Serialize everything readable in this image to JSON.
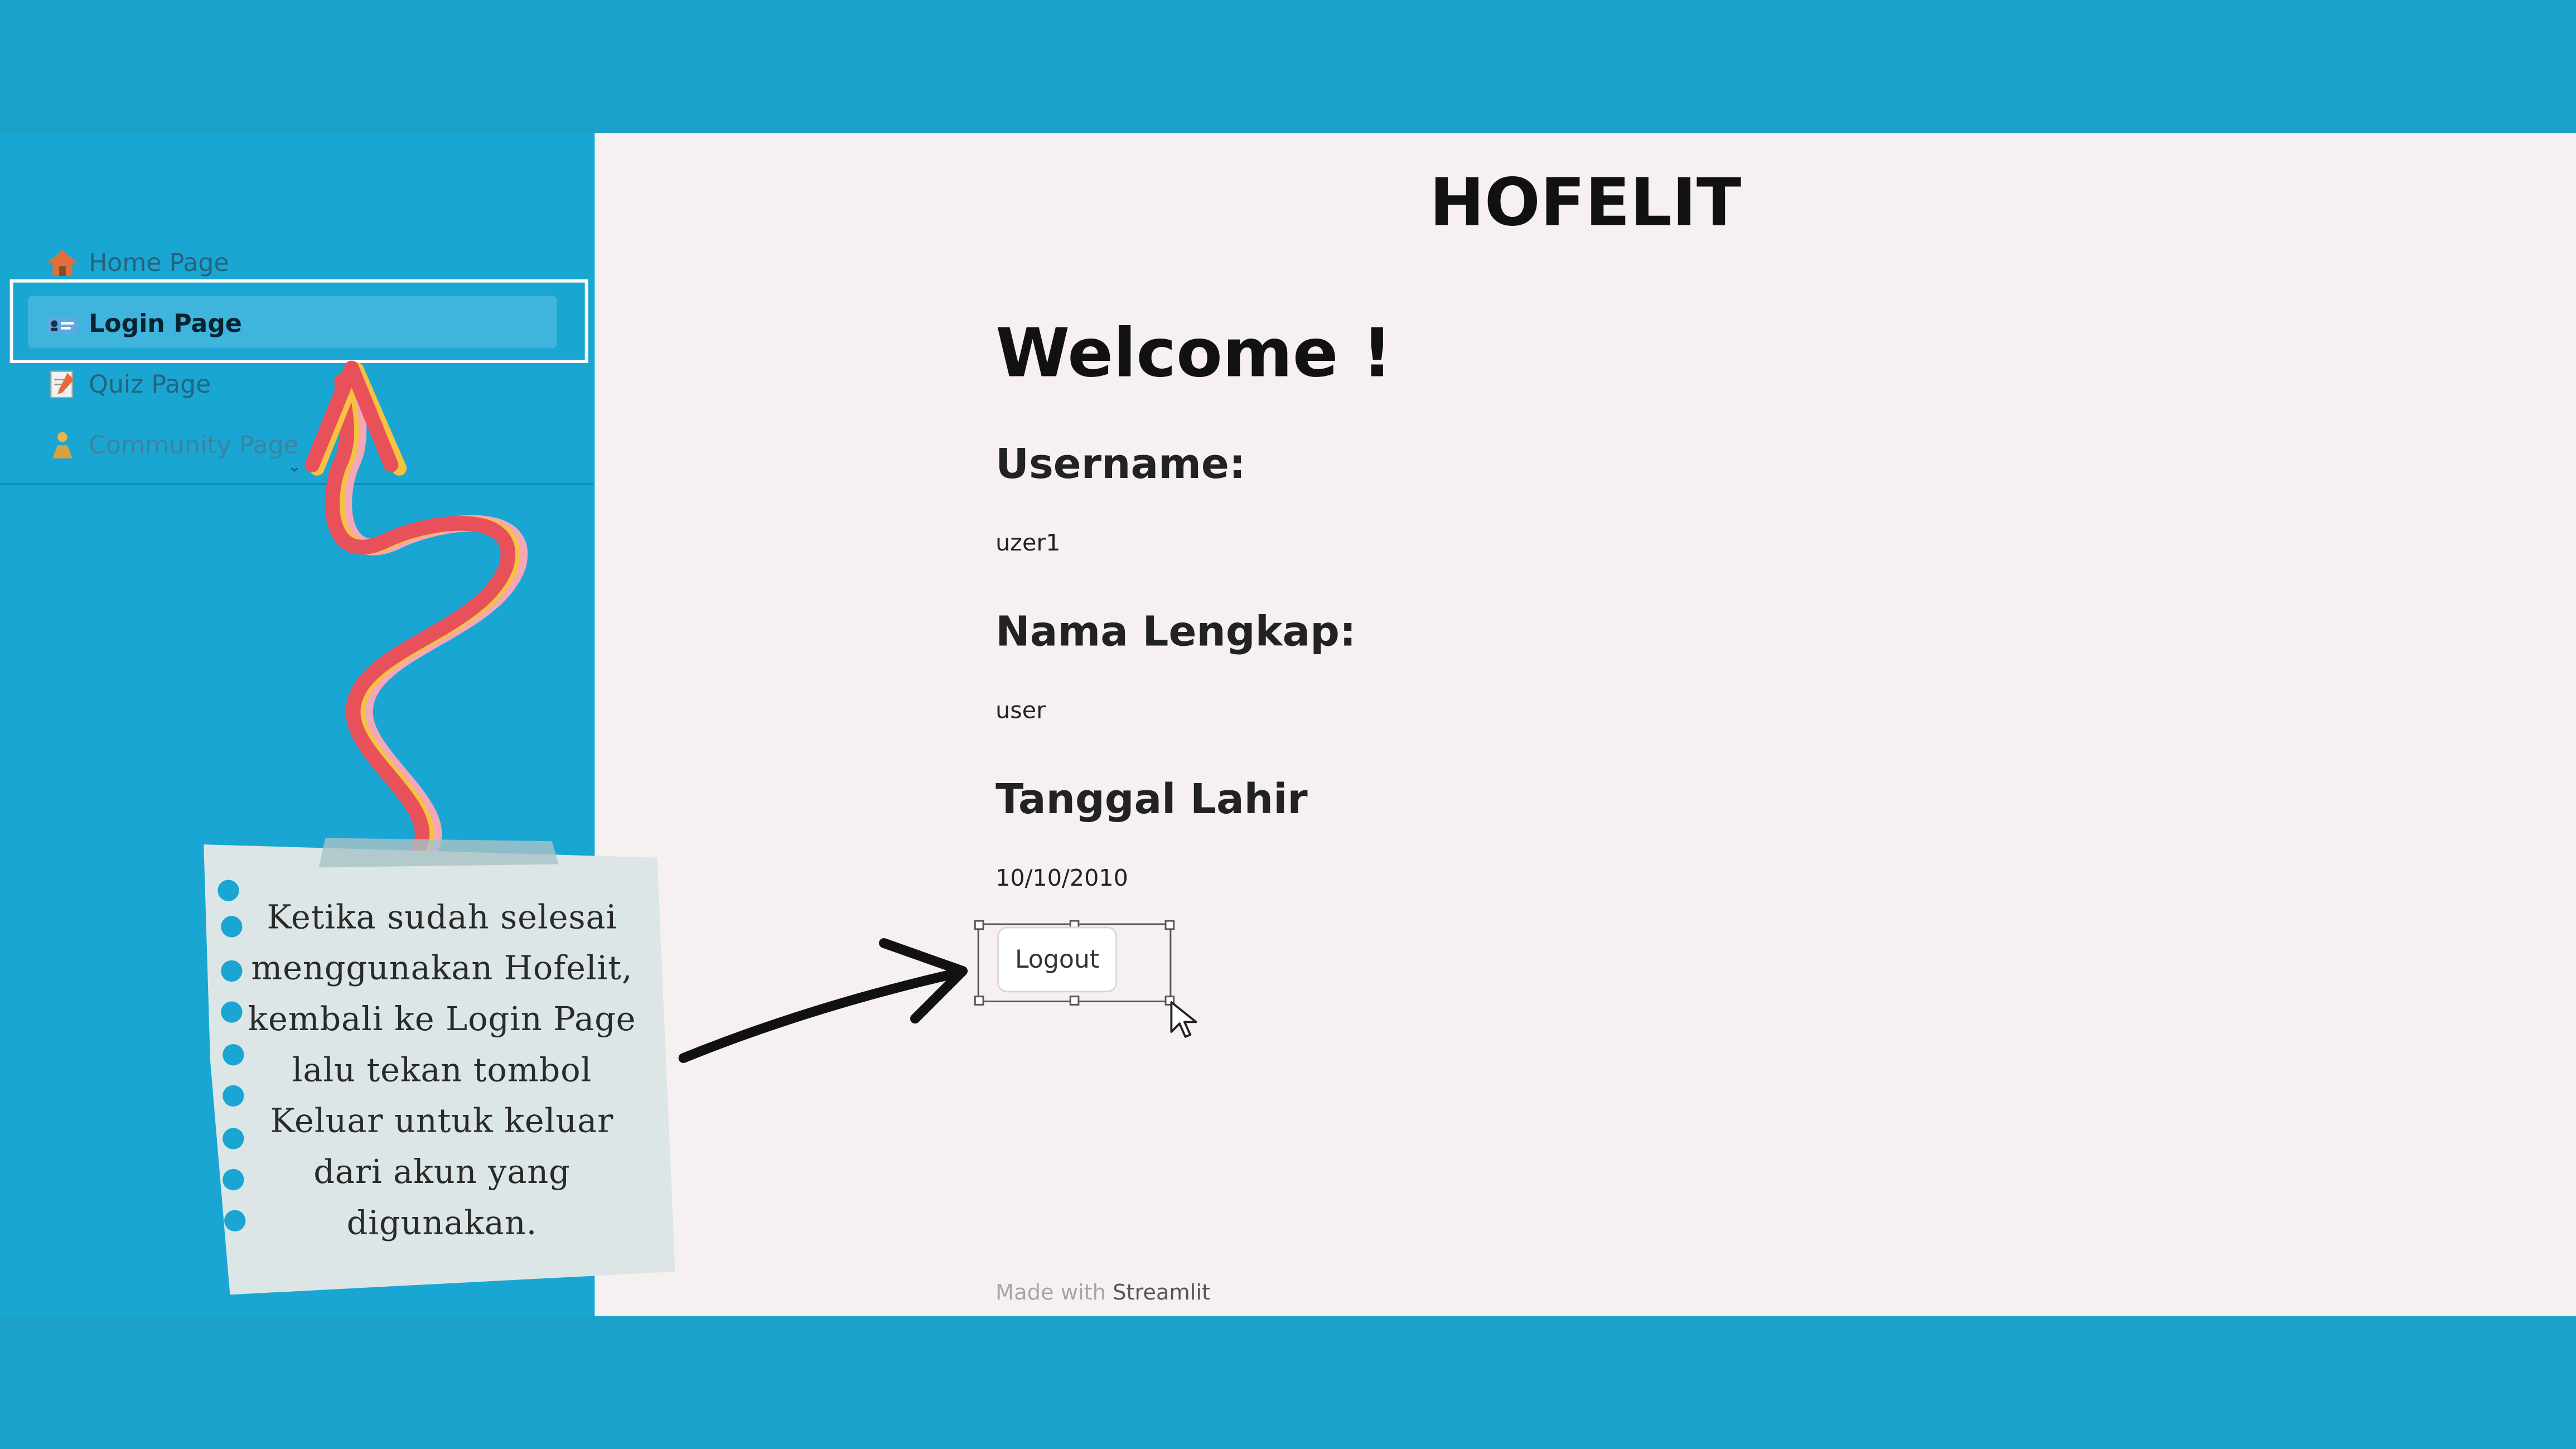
{
  "colors": {
    "frame_bg": "#1aa0c9",
    "sidebar_bg": "#1aa6d3",
    "main_bg": "#f7f0f0",
    "selected_nav_bg": "#3fb4dc",
    "annotation_red": "#e8515a",
    "annotation_yellow": "#f5c242",
    "annotation_pink": "#f4a7b9",
    "note_paper": "#dde6e6",
    "note_dot": "#1aa6d3"
  },
  "sidebar": {
    "items": [
      {
        "label": "Home Page",
        "icon": "house-icon"
      },
      {
        "label": "Login Page",
        "icon": "id-card-icon",
        "selected": true
      },
      {
        "label": "Quiz Page",
        "icon": "memo-icon"
      },
      {
        "label": "Community Page",
        "icon": "person-icon"
      }
    ]
  },
  "main": {
    "app_title": "HOFELIT",
    "welcome": "Welcome !",
    "username_label": "Username:",
    "username_value": "uzer1",
    "nama_label": "Nama Lengkap:",
    "nama_value": "user",
    "tanggal_label": "Tanggal Lahir",
    "tanggal_value": "10/10/2010",
    "logout_label": "Logout",
    "footer_prefix": "Made with",
    "footer_brand": "Streamlit"
  },
  "annotation": {
    "note_lines": [
      "Ketika sudah selesai",
      "menggunakan Hofelit,",
      "kembali ke Login Page",
      "lalu tekan tombol",
      "Keluar untuk keluar",
      "dari akun yang",
      "digunakan."
    ]
  }
}
